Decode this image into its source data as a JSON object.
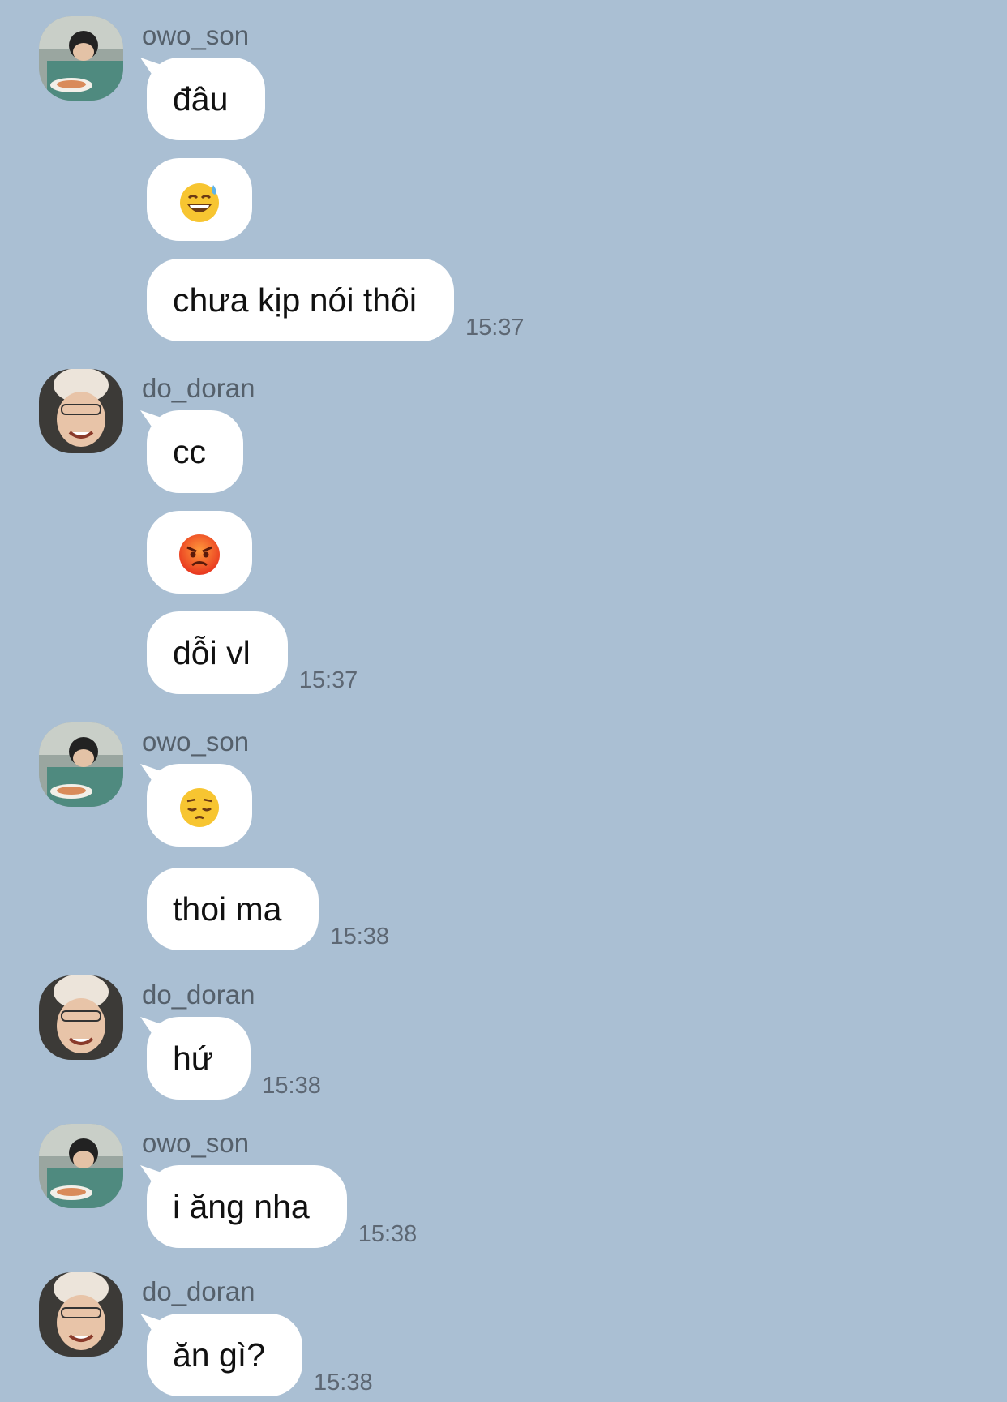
{
  "colors": {
    "background": "#aabfd3",
    "bubble": "#ffffff",
    "sender_text": "#55606b",
    "time_text": "#5d6773"
  },
  "senders": {
    "son": "owo_son",
    "doran": "do_doran"
  },
  "groups": [
    {
      "sender": "owo_son",
      "avatar": "owo-son-avatar",
      "messages": [
        {
          "text": "đâu"
        },
        {
          "emoji": "grinning-sweat-face-icon"
        },
        {
          "text": "chưa kịp nói thôi",
          "time": "15:37"
        }
      ]
    },
    {
      "sender": "do_doran",
      "avatar": "do-doran-avatar",
      "messages": [
        {
          "text": "cc"
        },
        {
          "emoji": "angry-face-icon"
        },
        {
          "text": "dỗi vl",
          "time": "15:37"
        }
      ]
    },
    {
      "sender": "owo_son",
      "avatar": "owo-son-avatar",
      "messages": [
        {
          "emoji": "pensive-face-icon"
        },
        {
          "text": "thoi ma",
          "time": "15:38"
        }
      ]
    },
    {
      "sender": "do_doran",
      "avatar": "do-doran-avatar",
      "messages": [
        {
          "text": "hứ",
          "time": "15:38"
        }
      ]
    },
    {
      "sender": "owo_son",
      "avatar": "owo-son-avatar",
      "messages": [
        {
          "text": "i ăng nha",
          "time": "15:38"
        }
      ]
    },
    {
      "sender": "do_doran",
      "avatar": "do-doran-avatar",
      "messages": [
        {
          "text": "ăn gì?",
          "time": "15:38"
        }
      ]
    }
  ]
}
